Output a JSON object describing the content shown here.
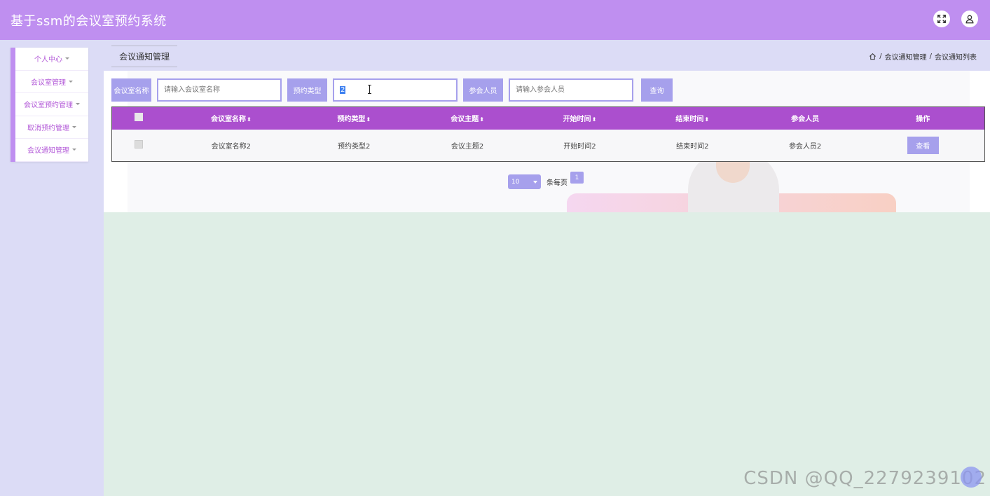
{
  "app": {
    "title": "基于ssm的会议室预约系统"
  },
  "topbar": {
    "fullscreen_icon": "expand-icon",
    "user_icon": "user-icon"
  },
  "sidebar": {
    "items": [
      {
        "label": "个人中心"
      },
      {
        "label": "会议室管理"
      },
      {
        "label": "会议室预约管理"
      },
      {
        "label": "取消预约管理"
      },
      {
        "label": "会议通知管理"
      }
    ]
  },
  "tabbar": {
    "active_tab": "会议通知管理"
  },
  "breadcrumb": {
    "home_icon": "home-icon",
    "sep": "/",
    "level1": "会议通知管理",
    "level2": "会议通知列表"
  },
  "search": {
    "room_name_label": "会议室名称",
    "room_name_placeholder": "请输入会议室名称",
    "type_label": "预约类型",
    "type_value": "2",
    "attendee_label": "参会人员",
    "attendee_placeholder": "请输入参会人员",
    "query_button": "查询"
  },
  "table": {
    "headers": [
      "会议室名称",
      "预约类型",
      "会议主题",
      "开始时间",
      "结束时间",
      "参会人员",
      "操作"
    ],
    "sort_glyph": "⬍",
    "rows": [
      {
        "room_name": "会议室名称2",
        "type": "预约类型2",
        "topic": "会议主题2",
        "start": "开始时间2",
        "end": "结束时间2",
        "attendees": "参会人员2",
        "action": "查看"
      }
    ]
  },
  "pagination": {
    "page_size": "10",
    "per_page_label": "条每页",
    "current_page": "1"
  },
  "watermark": "CSDN @QQ_2279239102",
  "colors": {
    "accent": "#bf8ff0",
    "table_header": "#ab4fce",
    "button": "#a6a0ec",
    "sidebar_text": "#b35ad8"
  }
}
